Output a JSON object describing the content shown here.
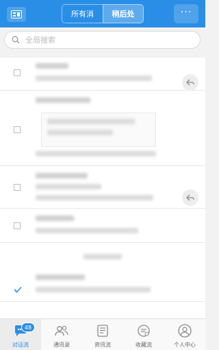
{
  "header": {
    "tabs": [
      {
        "label": "所有消息",
        "active": false
      },
      {
        "label": "稍后处理",
        "active": true
      }
    ],
    "more_label": "···"
  },
  "search": {
    "placeholder": "全局搜索"
  },
  "list": {
    "items": [
      {
        "checked": false,
        "has_reply": true
      },
      {
        "checked": false,
        "has_reply": false
      },
      {
        "checked": false,
        "has_reply": true
      },
      {
        "checked": false,
        "has_reply": false
      },
      {
        "checked": true,
        "has_reply": false
      }
    ]
  },
  "tabbar": {
    "items": [
      {
        "label": "对话流",
        "icon": "chat-icon",
        "active": true,
        "badge": "48"
      },
      {
        "label": "通讯录",
        "icon": "contacts-icon",
        "active": false
      },
      {
        "label": "资讯流",
        "icon": "news-icon",
        "active": false
      },
      {
        "label": "收藏流",
        "icon": "favorites-icon",
        "active": false
      },
      {
        "label": "个人中心",
        "icon": "profile-icon",
        "active": false
      }
    ]
  },
  "colors": {
    "accent": "#2a8ee6",
    "background": "#f2f2f2"
  }
}
